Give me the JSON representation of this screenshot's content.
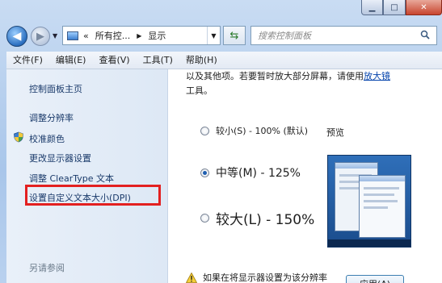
{
  "window": {
    "minimize_glyph": "▁",
    "maximize_glyph": "□",
    "close_glyph": "✕"
  },
  "nav": {
    "back_glyph": "◀",
    "forward_glyph": "▶",
    "dropdown_glyph": "▼"
  },
  "address": {
    "chevrons": "«",
    "crumbs": [
      "所有控...",
      "显示"
    ],
    "separator_glyph": "▶",
    "end_glyph": "▼"
  },
  "search": {
    "placeholder": "搜索控制面板",
    "icon": "search-icon"
  },
  "menubar": {
    "items": [
      "文件(F)",
      "编辑(E)",
      "查看(V)",
      "工具(T)",
      "帮助(H)"
    ]
  },
  "sidebar": {
    "links": [
      {
        "label": "控制面板主页"
      },
      {
        "label": "调整分辨率"
      },
      {
        "label": "校准颜色",
        "icon": "shield-icon"
      },
      {
        "label": "更改显示器设置"
      },
      {
        "label": "调整 ClearType 文本"
      },
      {
        "label": "设置自定义文本大小(DPI)"
      }
    ],
    "see_also": "另请参阅",
    "highlight_color": "#e32020"
  },
  "content": {
    "intro_text": "以及其他项。若要暂时放大部分屏幕，请使用",
    "intro_link": "放大镜",
    "intro_tail": "工具。",
    "options": [
      {
        "label": "较小(S) - 100% (默认)",
        "selected": false
      },
      {
        "label": "中等(M) - 125%",
        "selected": true
      },
      {
        "label": "较大(L) - 150%",
        "selected": false
      }
    ],
    "preview_label": "预览",
    "warning_text": "如果在将显示器设置为该分辨率",
    "apply_label": "应用(A)"
  }
}
